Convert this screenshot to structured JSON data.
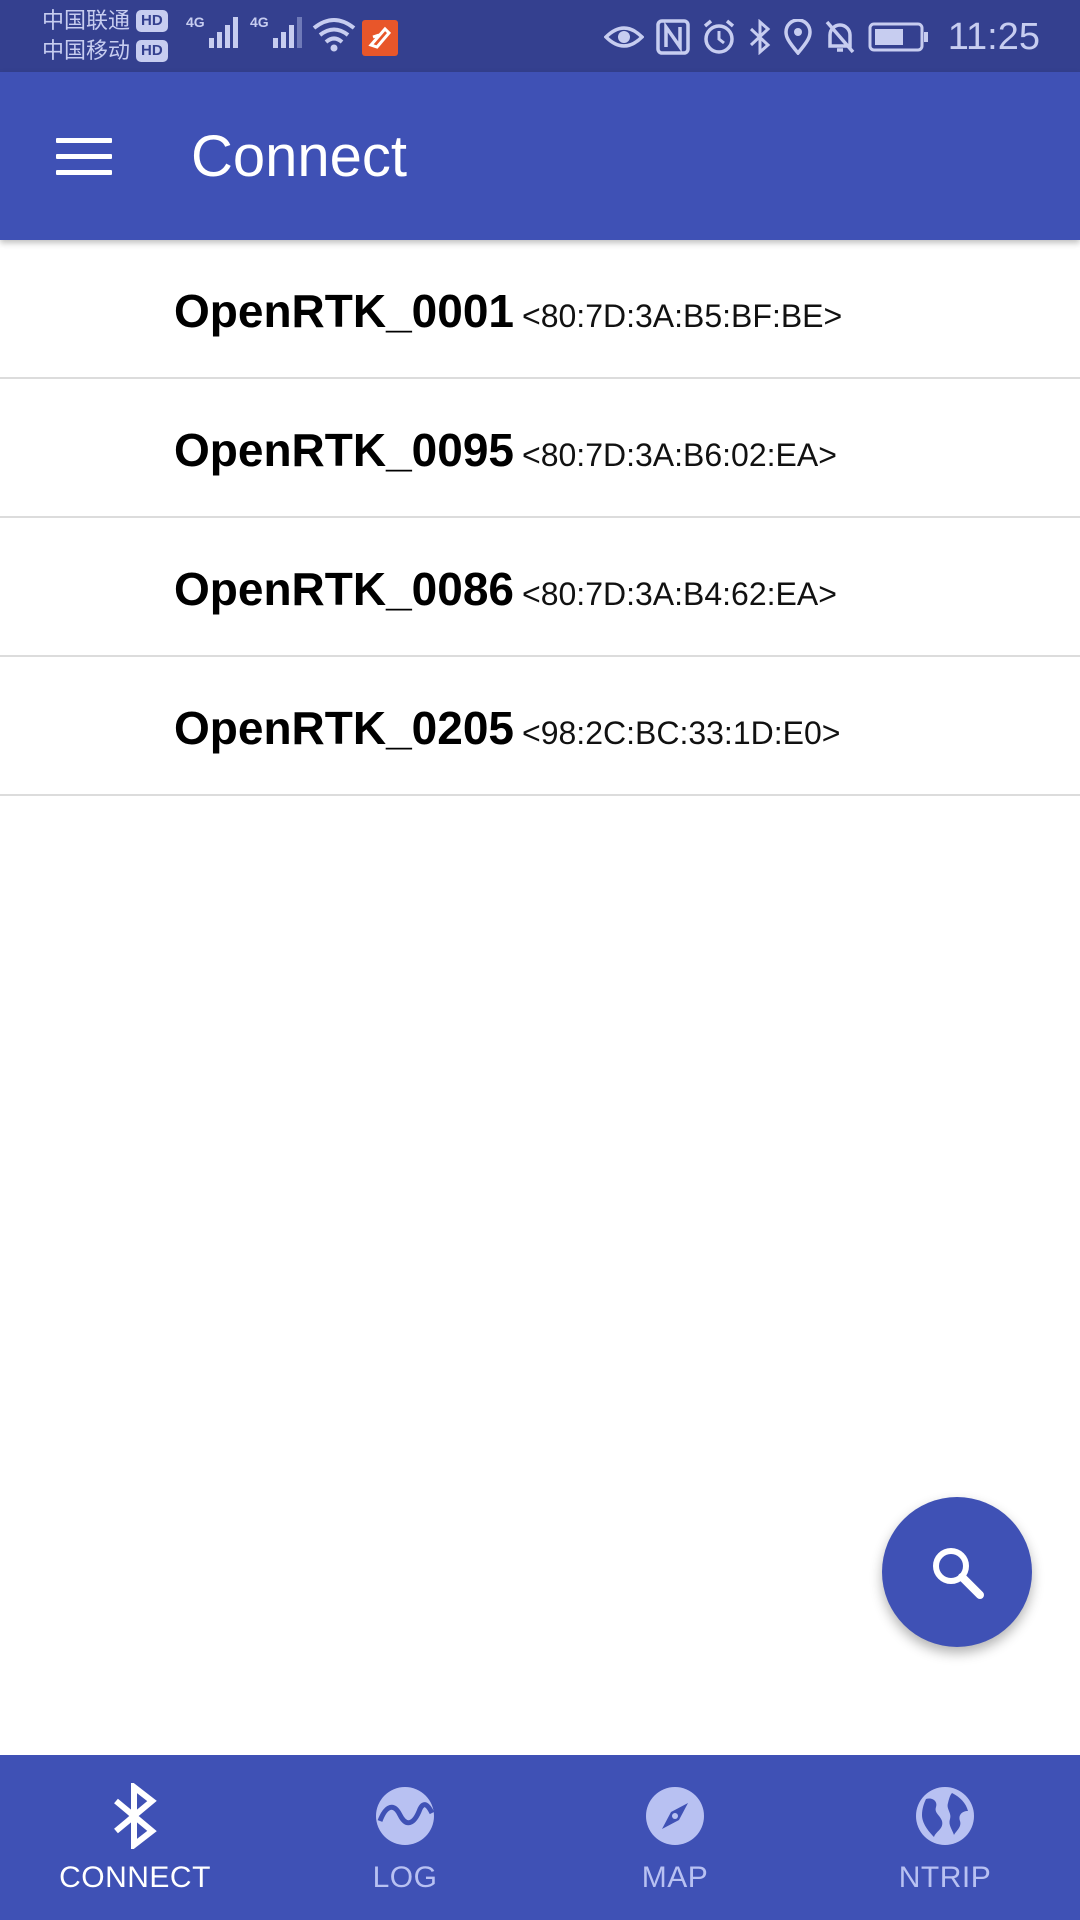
{
  "status_bar": {
    "carrier_1": "中国联通",
    "carrier_2": "中国移动",
    "hd_badge": "HD",
    "network_type": "4G",
    "time": "11:25"
  },
  "app_bar": {
    "title": "Connect",
    "menu_icon": "hamburger-menu-icon"
  },
  "devices": [
    {
      "name": "OpenRTK_0001",
      "address": "<80:7D:3A:B5:BF:BE>"
    },
    {
      "name": "OpenRTK_0095",
      "address": "<80:7D:3A:B6:02:EA>"
    },
    {
      "name": "OpenRTK_0086",
      "address": "<80:7D:3A:B4:62:EA>"
    },
    {
      "name": "OpenRTK_0205",
      "address": "<98:2C:BC:33:1D:E0>"
    }
  ],
  "fab": {
    "icon": "search-icon"
  },
  "bottom_nav": {
    "items": [
      {
        "label": "CONNECT",
        "icon": "bluetooth-icon",
        "active": true
      },
      {
        "label": "LOG",
        "icon": "wave-chart-icon",
        "active": false
      },
      {
        "label": "MAP",
        "icon": "compass-icon",
        "active": false
      },
      {
        "label": "NTRIP",
        "icon": "globe-icon",
        "active": false
      }
    ]
  },
  "colors": {
    "primary": "#3f51b5",
    "status_bar": "#34408f",
    "inactive_nav": "#b8c1f2"
  }
}
